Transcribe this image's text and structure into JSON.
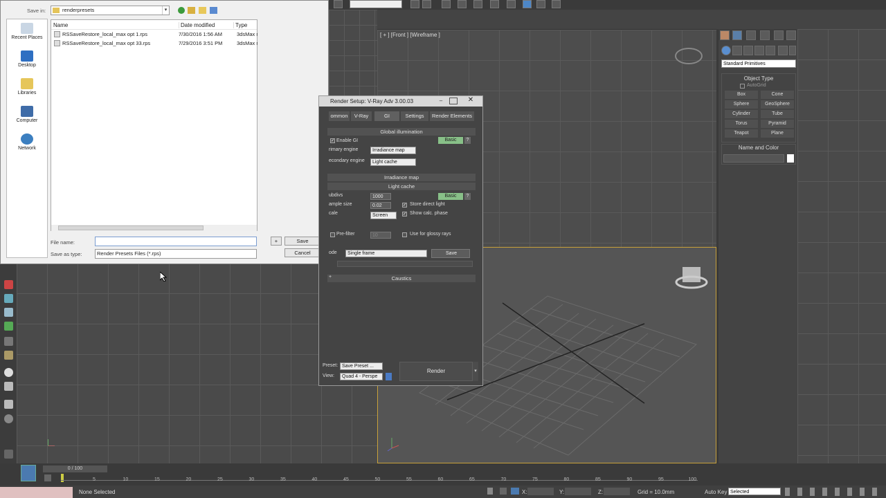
{
  "save_dialog": {
    "save_in_label": "Save in:",
    "save_in_value": "renderpresets",
    "sidebar": [
      {
        "label": "Recent Places",
        "icon": "recent-places-icon"
      },
      {
        "label": "Desktop",
        "icon": "desktop-icon"
      },
      {
        "label": "Libraries",
        "icon": "libraries-icon"
      },
      {
        "label": "Computer",
        "icon": "computer-icon"
      },
      {
        "label": "Network",
        "icon": "network-icon"
      }
    ],
    "columns": [
      "Name",
      "Date modified",
      "Type"
    ],
    "files": [
      {
        "name": "RSSaveRestore_local_max opt 1.rps",
        "date": "7/30/2016 1:56 AM",
        "type": "3dsMax re"
      },
      {
        "name": "RSSaveRestore_local_max opt 33.rps",
        "date": "7/29/2016 3:51 PM",
        "type": "3dsMax re"
      }
    ],
    "file_name_label": "File name:",
    "file_name_value": "",
    "save_as_type_label": "Save as type:",
    "save_as_type_value": "Render Presets Files (*.rps)",
    "plus_label": "+",
    "save_label": "Save",
    "cancel_label": "Cancel"
  },
  "render_setup": {
    "title": "Render Setup: V-Ray Adv 3.00.03",
    "tabs": [
      "ommon",
      "V-Ray",
      "GI",
      "Settings",
      "Render Elements"
    ],
    "gi_header": "Global illumination",
    "enable_gi": "Enable GI",
    "basic_label": "Basic",
    "help_label": "?",
    "primary_engine_label": "rimary engine",
    "primary_engine_value": "Irradiance map",
    "secondary_engine_label": "econdary engine",
    "secondary_engine_value": "Light cache",
    "irradiance_header": "Irradiance map",
    "light_cache_header": "Light cache",
    "subdivs_label": "ubdivs",
    "subdivs_value": "1000",
    "sample_size_label": "ample size",
    "sample_size_value": "0.02",
    "scale_label": "cale",
    "scale_value": "Screen",
    "store_direct_light": "Store direct light",
    "show_calc_phase": "Show calc. phase",
    "prefilter_label": "Pre-filter",
    "prefilter_value": "10",
    "use_glossy": "Use for glossy rays",
    "mode_label": "ode",
    "mode_value": "Single frame",
    "mode_save_label": "Save",
    "caustics_header": "Caustics",
    "caustics_plus": "+",
    "preset_label": "Preset:",
    "preset_value": "Save Preset ...",
    "view_label": "View:",
    "view_value": "Quad 4 - Perspe",
    "render_label": "Render"
  },
  "viewport": {
    "front_label": "[ + ] [Front ] [Wireframe ]"
  },
  "command_panel": {
    "category": "Standard Primitives",
    "object_type_header": "Object Type",
    "autogrid": "AutoGrid",
    "primitives": [
      "Box",
      "Cone",
      "Sphere",
      "GeoSphere",
      "Cylinder",
      "Tube",
      "Torus",
      "Pyramid",
      "Teapot",
      "Plane"
    ],
    "name_color_header": "Name and Color",
    "swatch_color": "#ffffff"
  },
  "timeline": {
    "frame_counter": "0 / 100",
    "ticks": [
      "5",
      "10",
      "15",
      "20",
      "25",
      "30",
      "35",
      "40",
      "45",
      "50",
      "55",
      "60",
      "65",
      "70",
      "75",
      "80",
      "85",
      "90",
      "95",
      "100"
    ]
  },
  "status": {
    "selection": "None Selected",
    "x_label": "X:",
    "y_label": "Y:",
    "z_label": "Z:",
    "grid": "Grid = 10.0mm",
    "auto_key": "Auto Key",
    "selected_value": "Selected"
  }
}
